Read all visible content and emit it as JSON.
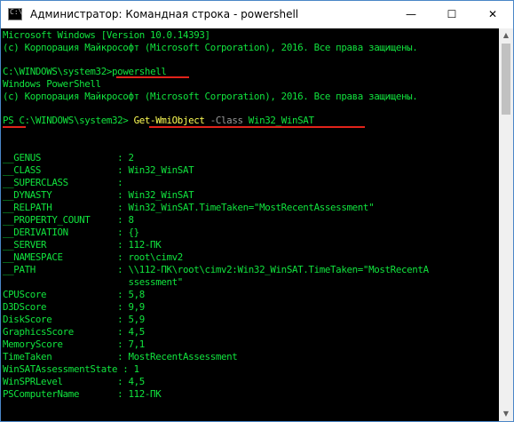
{
  "window": {
    "title": "Администратор: Командная строка - powershell",
    "icon_glyph": "C:\\",
    "minimize_glyph": "—",
    "maximize_glyph": "☐",
    "close_glyph": "✕"
  },
  "console": {
    "banner_line1": "Microsoft Windows [Version 10.0.14393]",
    "banner_line2": "(c) Корпорация Майкрософт (Microsoft Corporation), 2016. Все права защищены.",
    "cmd_prompt": "C:\\WINDOWS\\system32>",
    "cmd_command": "powershell",
    "ps_line1": "Windows PowerShell",
    "ps_line2": "(c) Корпорация Майкрософт (Microsoft Corporation), 2016. Все права защищены.",
    "ps_prompt": "PS C:\\WINDOWS\\system32> ",
    "ps_cmdlet": "Get-WmiObject",
    "ps_param": " -Class",
    "ps_arg": " Win32_WinSAT",
    "properties": [
      "__GENUS              : 2",
      "__CLASS              : Win32_WinSAT",
      "__SUPERCLASS         :",
      "__DYNASTY            : Win32_WinSAT",
      "__RELPATH            : Win32_WinSAT.TimeTaken=\"MostRecentAssessment\"",
      "__PROPERTY_COUNT     : 8",
      "__DERIVATION         : {}",
      "__SERVER             : 112-ПК",
      "__NAMESPACE          : root\\cimv2",
      "__PATH               : \\\\112-ПК\\root\\cimv2:Win32_WinSAT.TimeTaken=\"MostRecentA",
      "                       ssessment\"",
      "CPUScore             : 5,8",
      "D3DScore             : 9,9",
      "DiskScore            : 5,9",
      "GraphicsScore        : 4,5",
      "MemoryScore          : 7,1",
      "TimeTaken            : MostRecentAssessment",
      "WinSATAssessmentState : 1",
      "WinSPRLevel          : 4,5",
      "PSComputerName       : 112-ПК"
    ]
  },
  "scrollbar": {
    "up_glyph": "▲",
    "down_glyph": "▼"
  },
  "colors": {
    "console_bg": "#000000",
    "console_text": "#11e43e",
    "cmdlet": "#ffff55",
    "parameter": "#9a9a9a",
    "annotation": "#e2231a"
  }
}
